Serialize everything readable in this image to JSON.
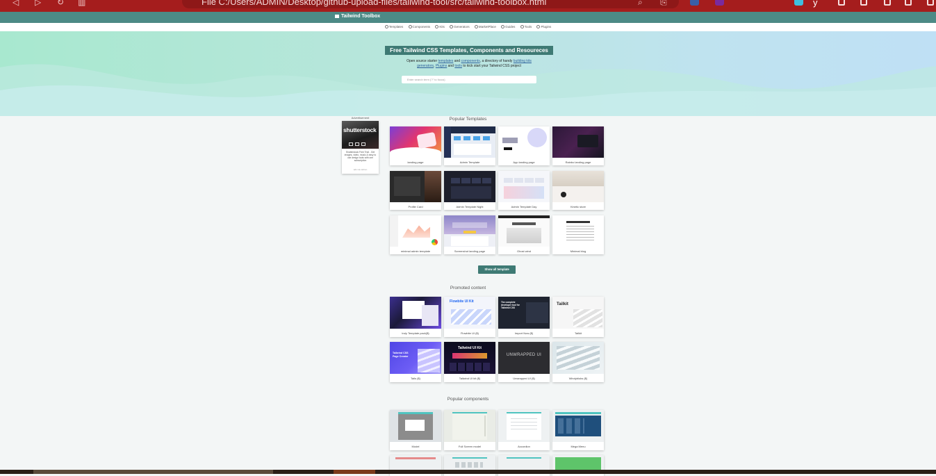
{
  "browser": {
    "address": "File  C:/Users/ADMIN/Desktop/github-upload-files/tailwind-tool/src/tailwind-toolbox.html",
    "profile_initial": "y"
  },
  "header": {
    "brand": "Tailwind Toolbox"
  },
  "nav": {
    "items": [
      "Templates",
      "Components",
      "Kits",
      "Generators",
      "MarketPlace",
      "Guides",
      "Tools",
      "Plugins"
    ]
  },
  "hero": {
    "title": "Free Tailwind CSS Templates, Components and Resoureces",
    "desc_part1": "Open source starter ",
    "desc_link1": "templates",
    "desc_part2": " and ",
    "desc_link2": "components",
    "desc_part3": ", a directory of handy ",
    "desc_link3": "building kits",
    "desc_part4": " ",
    "desc_link4": "generators",
    "desc_part5": ", ",
    "desc_link5": "Plugins",
    "desc_part6": " and ",
    "desc_link6": "tools",
    "desc_part7": " to kick start your Tailwind CSS project",
    "search_placeholder": "Enter search term (\"/\" to focus)"
  },
  "advertisement": {
    "title": "Advertisement",
    "logo": "shutterstock",
    "text": "Shutterstock Free Trial - Get images, video, music & easy to use design tools with one subscription",
    "footer": "ads via carbon"
  },
  "popular_templates": {
    "title": "Popular Templates",
    "items": [
      "landing page",
      "Admin Template",
      "App landing page",
      "Rainbo landing page",
      "Profile Card",
      "Admin Template Night",
      "Admin Template Day",
      "Kinetic store",
      "minimal admin template",
      "Screenshot landing page",
      "Ghost wind",
      "Minimal blog"
    ],
    "show_all": "Show all template"
  },
  "promoted": {
    "title": "Promoted content",
    "items": [
      "truly Template pack($)",
      "Flowbite UI ($)",
      "Import Now ($)",
      "Tailkit",
      "Tails ($)",
      "Tailwind UI kit ($)",
      "Unwrapped UI ($)",
      "Windybloks ($)"
    ],
    "thumb_texts": {
      "flowbite": "Flowbite UI Kit",
      "tailkit": "Tailkit",
      "tails": "Tailwind CSS Page Creator",
      "tailwind_ui_kit": "Tailwind UI Kit",
      "unwrapped": "UNWRAPPED UI",
      "import_now": "The complete developer tool for Tailwind CSS"
    }
  },
  "popular_components": {
    "title": "Popular components",
    "items": [
      "Model",
      "Full Screen model",
      "Accordion",
      "Mega Menu"
    ]
  },
  "colors": {
    "primary": "#3e7a74",
    "header": "#4d8a86",
    "browser": "#a51d1d"
  }
}
